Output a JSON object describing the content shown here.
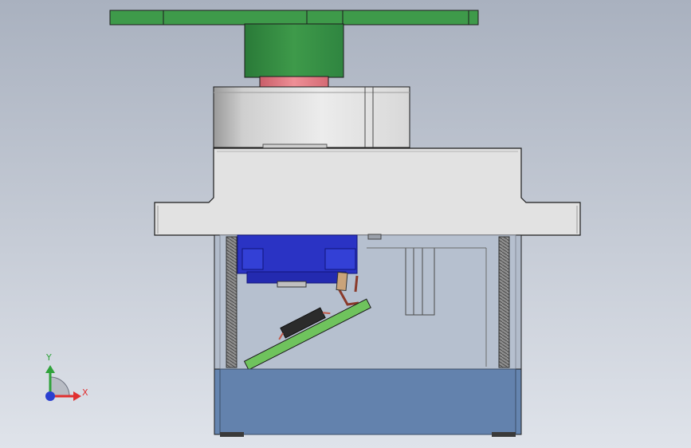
{
  "viewport": {
    "background_top": "#a9b1bf",
    "background_bottom": "#dfe3ea"
  },
  "model": {
    "parts": [
      "horn",
      "output-shaft",
      "motor-cap",
      "mounting-flange",
      "transparent-case",
      "motor",
      "circuit-board",
      "resistor",
      "threaded-rod-left",
      "threaded-rod-right",
      "gear-post",
      "bottom-cover"
    ],
    "colors": {
      "horn": "#3e9a4a",
      "shaft": "#e37e86",
      "cap": "#dcdcdc",
      "flange": "#e2e2e2",
      "case": "#b2bccb",
      "motor": "#2a33c4",
      "pcb": "#6fc35d",
      "bottom": "#6585b0",
      "outline": "#1c1c1c"
    }
  },
  "triad": {
    "x_label": "X",
    "y_label": "Y",
    "x_color": "#e03030",
    "y_color": "#2fa23a",
    "z_color": "#2a3fd0"
  }
}
